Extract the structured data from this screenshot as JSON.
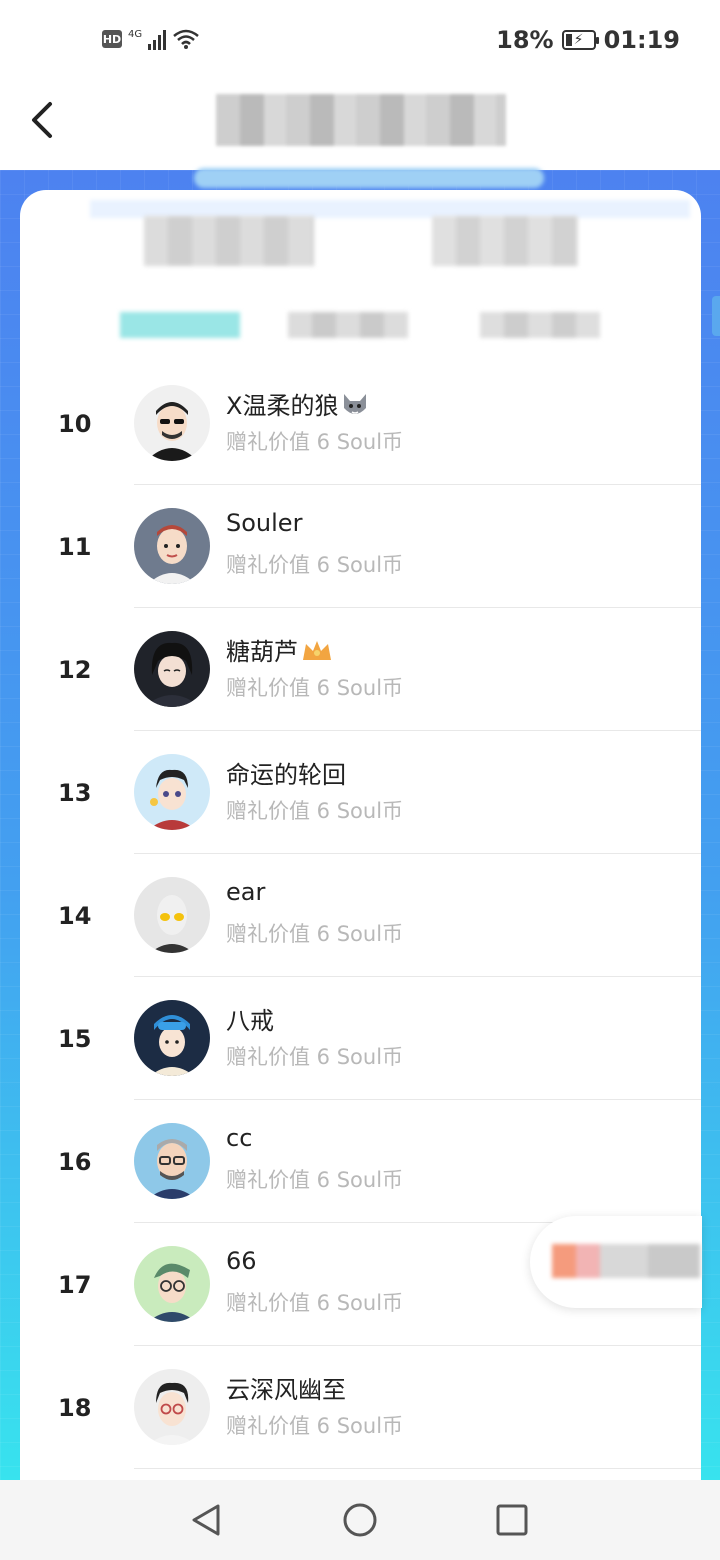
{
  "status_bar": {
    "hd": "HD",
    "network": "4G",
    "battery": "18%",
    "time": "01:19"
  },
  "list": {
    "rows": [
      {
        "rank": "10",
        "name": "X温柔的狼",
        "emoji": "wolf",
        "value": "赠礼价值 6 Soul币"
      },
      {
        "rank": "11",
        "name": "Souler",
        "emoji": "",
        "value": "赠礼价值 6 Soul币"
      },
      {
        "rank": "12",
        "name": "糖葫芦",
        "emoji": "crown",
        "value": "赠礼价值 6 Soul币"
      },
      {
        "rank": "13",
        "name": "命运的轮回",
        "emoji": "",
        "value": "赠礼价值 6 Soul币"
      },
      {
        "rank": "14",
        "name": "ear",
        "emoji": "",
        "value": "赠礼价值 6 Soul币"
      },
      {
        "rank": "15",
        "name": "八戒",
        "emoji": "",
        "value": "赠礼价值 6 Soul币"
      },
      {
        "rank": "16",
        "name": "cc",
        "emoji": "",
        "value": "赠礼价值 6 Soul币"
      },
      {
        "rank": "17",
        "name": "66",
        "emoji": "",
        "value": "赠礼价值 6 Soul币"
      },
      {
        "rank": "18",
        "name": "云深风幽至",
        "emoji": "",
        "value": "赠礼价值 6 Soul币"
      }
    ]
  },
  "colors": {
    "accent_top": "#4d82f0",
    "accent_bottom": "#38e3ee"
  },
  "icons": [
    "back-arrow-icon",
    "wifi-icon",
    "battery-icon",
    "nav-back-icon",
    "nav-home-icon",
    "nav-recents-icon"
  ]
}
